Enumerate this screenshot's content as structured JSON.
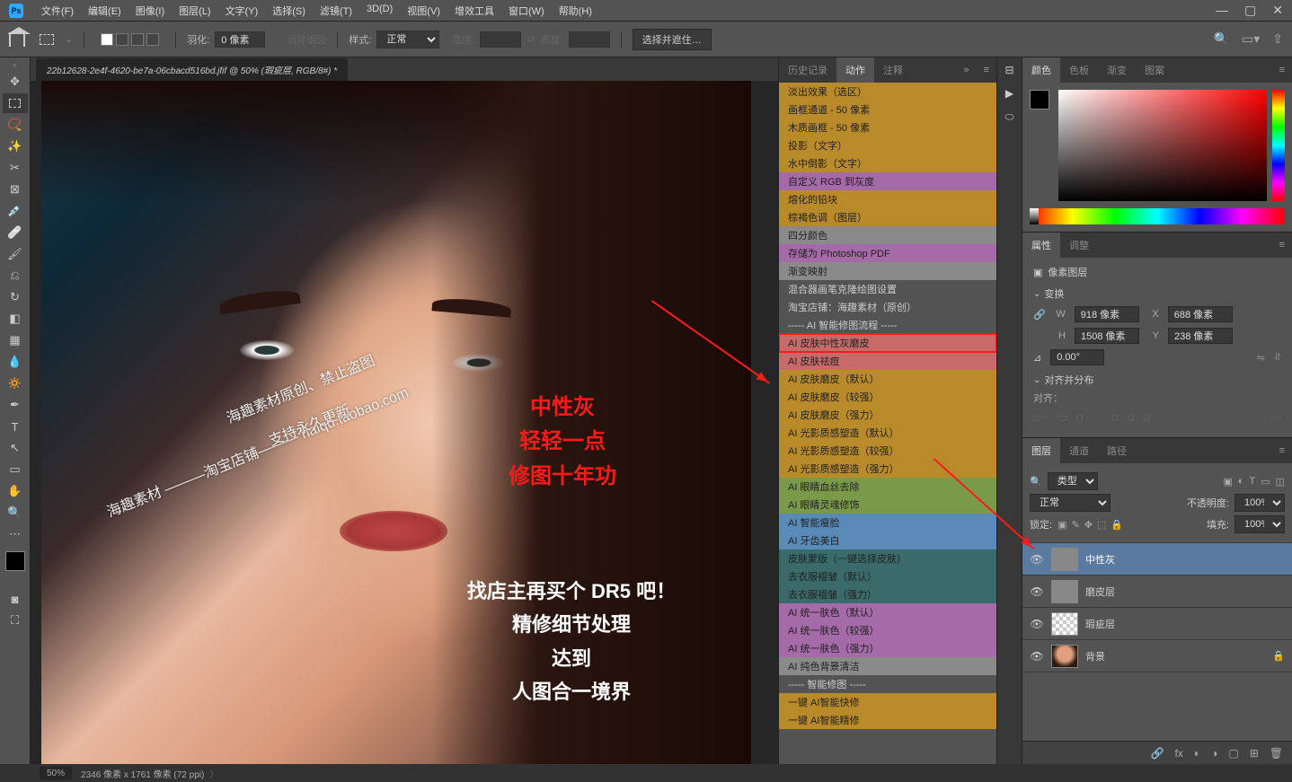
{
  "menubar": {
    "items": [
      "文件(F)",
      "编辑(E)",
      "图像(I)",
      "图层(L)",
      "文字(Y)",
      "选择(S)",
      "滤镜(T)",
      "3D(D)",
      "视图(V)",
      "增效工具",
      "窗口(W)",
      "帮助(H)"
    ]
  },
  "optionsbar": {
    "feather_label": "羽化:",
    "feather_value": "0 像素",
    "antialias": "消除锯齿",
    "style_label": "样式:",
    "style_value": "正常",
    "width_label": "宽度:",
    "height_label": "高度:",
    "mask_btn": "选择并遮住…"
  },
  "document": {
    "tab": "22b12628-2e4f-4620-be7a-06cbacd516bd.jfif @ 50% (瑕疵层, RGB/8#) *",
    "watermarks": {
      "wm1": "海趣素材 ———淘宝店铺——— haiqu.taobao.com",
      "wm2": "海趣素材原创、禁止盗图",
      "wm3": "支持永久更新"
    },
    "red_text": "中性灰\n轻轻一点\n修图十年功",
    "white_text": "找店主再买个 DR5 吧！\n精修细节处理\n达到\n人图合一境界"
  },
  "panels": {
    "history_tab": "历史记录",
    "actions_tab": "动作",
    "comments_tab": "注释",
    "actions": [
      {
        "label": "淡出效果（选区）",
        "bg": "#b88a2a"
      },
      {
        "label": "画框通道 - 50 像素",
        "bg": "#b88a2a"
      },
      {
        "label": "木质画框 - 50 像素",
        "bg": "#b88a2a"
      },
      {
        "label": "投影（文字）",
        "bg": "#b88a2a"
      },
      {
        "label": "水中倒影（文字）",
        "bg": "#b88a2a"
      },
      {
        "label": "自定义 RGB 到灰度",
        "bg": "#a56aa8"
      },
      {
        "label": "熔化的铅块",
        "bg": "#b88a2a"
      },
      {
        "label": "棕褐色调（图层）",
        "bg": "#b88a2a"
      },
      {
        "label": "四分颜色",
        "bg": "#8a8a8a"
      },
      {
        "label": "存储为 Photoshop PDF",
        "bg": "#a56aa8"
      },
      {
        "label": "渐变映射",
        "bg": "#8a8a8a"
      },
      {
        "label": "混合器画笔克隆绘图设置",
        "bg": "#535353",
        "fg": "#ccc"
      },
      {
        "label": "淘宝店铺：海趣素材（原创）",
        "bg": "#535353",
        "fg": "#ccc"
      },
      {
        "label": "----- AI 智能修图流程 -----",
        "bg": "#535353",
        "fg": "#ccc"
      },
      {
        "label": "AI 皮肤中性灰磨皮",
        "bg": "#c86a6a",
        "hl": true
      },
      {
        "label": "AI 皮肤祛痘",
        "bg": "#c86a6a"
      },
      {
        "label": "AI 皮肤磨皮（默认）",
        "bg": "#b88a2a"
      },
      {
        "label": "AI 皮肤磨皮（较强）",
        "bg": "#b88a2a"
      },
      {
        "label": "AI 皮肤磨皮（强力）",
        "bg": "#b88a2a"
      },
      {
        "label": "AI 光影质感塑造（默认）",
        "bg": "#b88a2a"
      },
      {
        "label": "AI 光影质感塑造（较强）",
        "bg": "#b88a2a"
      },
      {
        "label": "AI 光影质感塑造（强力）",
        "bg": "#b88a2a"
      },
      {
        "label": "AI 眼睛血丝去除",
        "bg": "#7a9a4a"
      },
      {
        "label": "AI 眼睛灵魂修饰",
        "bg": "#7a9a4a"
      },
      {
        "label": "AI 智能瘦脸",
        "bg": "#5a8ab8"
      },
      {
        "label": "AI 牙齿美白",
        "bg": "#5a8ab8"
      },
      {
        "label": "皮肤蒙版（一键选择皮肤）",
        "bg": "#3a6a6a"
      },
      {
        "label": "去衣服褶皱（默认）",
        "bg": "#3a6a6a"
      },
      {
        "label": "去衣服褶皱（强力）",
        "bg": "#3a6a6a"
      },
      {
        "label": "AI 统一肤色（默认）",
        "bg": "#a56aa8"
      },
      {
        "label": "AI 统一肤色（较强）",
        "bg": "#a56aa8"
      },
      {
        "label": "AI 统一肤色（强力）",
        "bg": "#a56aa8"
      },
      {
        "label": "AI 纯色背景清洁",
        "bg": "#8a8a8a"
      },
      {
        "label": "----- 智能修图 -----",
        "bg": "#535353",
        "fg": "#ccc"
      },
      {
        "label": "一键 AI智能快修",
        "bg": "#b88a2a"
      },
      {
        "label": "一键 AI智能精修",
        "bg": "#b88a2a"
      }
    ],
    "color_tab": "颜色",
    "swatches_tab": "色板",
    "gradients_tab": "渐变",
    "patterns_tab": "图案",
    "props_tab": "属性",
    "adjust_tab": "调整",
    "props": {
      "type": "像素图层",
      "transform_hdr": "变换",
      "w_label": "W",
      "w_value": "918 像素",
      "x_label": "X",
      "x_value": "688 像素",
      "h_label": "H",
      "h_value": "1508 像素",
      "y_label": "Y",
      "y_value": "238 像素",
      "angle": "0.00°",
      "align_hdr": "对齐并分布",
      "align_label": "对齐："
    },
    "layers_tab": "图层",
    "channels_tab": "通道",
    "paths_tab": "路径",
    "layers": {
      "kind_label": "类型",
      "blend": "正常",
      "opacity_label": "不透明度:",
      "opacity": "100%",
      "lock_label": "锁定:",
      "fill_label": "填充:",
      "fill": "100%",
      "items": [
        {
          "name": "中性灰",
          "sel": true,
          "thumb": "gray"
        },
        {
          "name": "磨皮层",
          "thumb": "gray"
        },
        {
          "name": "瑕疵层",
          "thumb": "checker"
        },
        {
          "name": "背景",
          "thumb": "face",
          "locked": true
        }
      ]
    }
  },
  "statusbar": {
    "zoom": "50%",
    "info": "2346 像素 x 1761 像素 (72 ppi)"
  }
}
